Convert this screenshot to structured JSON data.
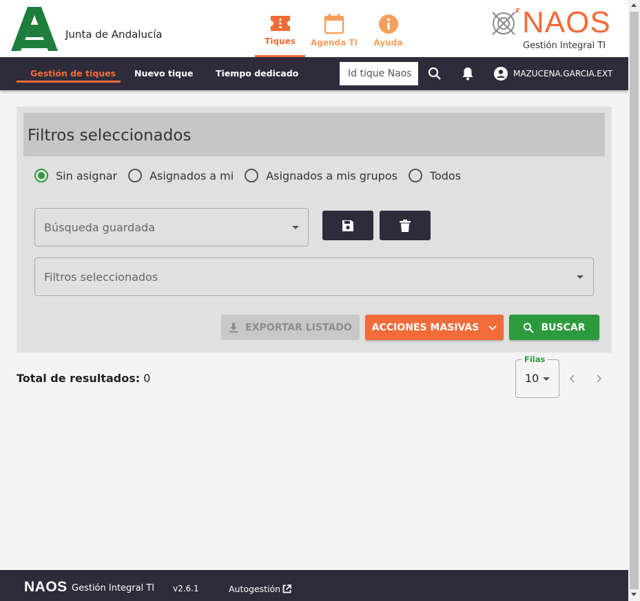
{
  "header": {
    "org_name": "Junta de Andalucía",
    "tabs": [
      {
        "label": "Tiques",
        "icon": "ticket-icon",
        "active": true
      },
      {
        "label": "Agenda TI",
        "icon": "calendar-icon",
        "active": false
      },
      {
        "label": "Ayuda",
        "icon": "info-icon",
        "active": false
      }
    ],
    "brand": "NAOS",
    "brand_subtitle": "Gestión  Integral TI"
  },
  "navbar": {
    "links": [
      "Gestión de tiques",
      "Nuevo tique",
      "Tiempo dedicado"
    ],
    "search_placeholder": "Id tique Naos",
    "user": "MAZUCENA.GARCIA.EXT"
  },
  "filters": {
    "title": "Filtros seleccionados",
    "radio_options": [
      "Sin asignar",
      "Asignados a mi",
      "Asignados a mis grupos",
      "Todos"
    ],
    "selected_radio": "Sin asignar",
    "saved_search_placeholder": "Búsqueda guardada",
    "selected_filters_placeholder": "Filtros seleccionados",
    "export_label": "EXPORTAR LISTADO",
    "mass_actions_label": "ACCIONES MASIVAS",
    "search_label": "BUSCAR"
  },
  "results": {
    "total_label": "Total de resultados:",
    "total_value": "0",
    "rows_label": "Filas",
    "rows_value": "10"
  },
  "footer": {
    "brand": "NAOS",
    "subtitle": "Gestión  Integral TI",
    "version": "v2.6.1",
    "link": "Autogestión"
  },
  "colors": {
    "accent": "#f26b39",
    "dark": "#2e2c3a",
    "green": "#2e9a3e"
  }
}
